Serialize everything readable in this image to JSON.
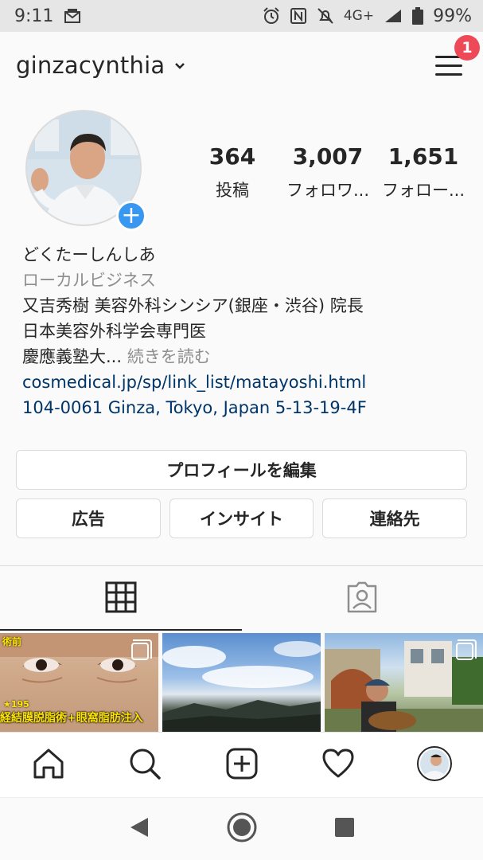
{
  "status_bar": {
    "time": "9:11",
    "network": "4G+",
    "battery": "99%",
    "icons": [
      "notification-icon",
      "alarm-icon",
      "nfc-icon",
      "mute-icon",
      "signal-icon",
      "battery-icon"
    ]
  },
  "header": {
    "username": "ginzacynthia",
    "notification_count": "1"
  },
  "stats": [
    {
      "value": "364",
      "label": "投稿"
    },
    {
      "value": "3,007",
      "label": "フォロワ..."
    },
    {
      "value": "1,651",
      "label": "フォロー..."
    }
  ],
  "bio": {
    "name": "どくたーしんしあ",
    "category": "ローカルビジネス",
    "line1": "又吉秀樹 美容外科シンシア(銀座・渋谷) 院長",
    "line2": "日本美容外科学会専門医",
    "line3": "慶應義塾大...",
    "more": "続きを読む",
    "link": "cosmedical.jp/sp/link_list/matayoshi.html",
    "address": "104-0061 Ginza, Tokyo, Japan 5-13-19-4F"
  },
  "buttons": {
    "edit_profile": "プロフィールを編集",
    "ads": "広告",
    "insights": "インサイト",
    "contact": "連絡先"
  },
  "grid": {
    "post1_top": "術前",
    "post1_star": "★195",
    "post1_caption": "経結膜脱脂術+眼窩脂肪注入"
  },
  "colors": {
    "accent_blue": "#3897f0",
    "badge_red": "#ed4956",
    "link_color": "#003569"
  }
}
